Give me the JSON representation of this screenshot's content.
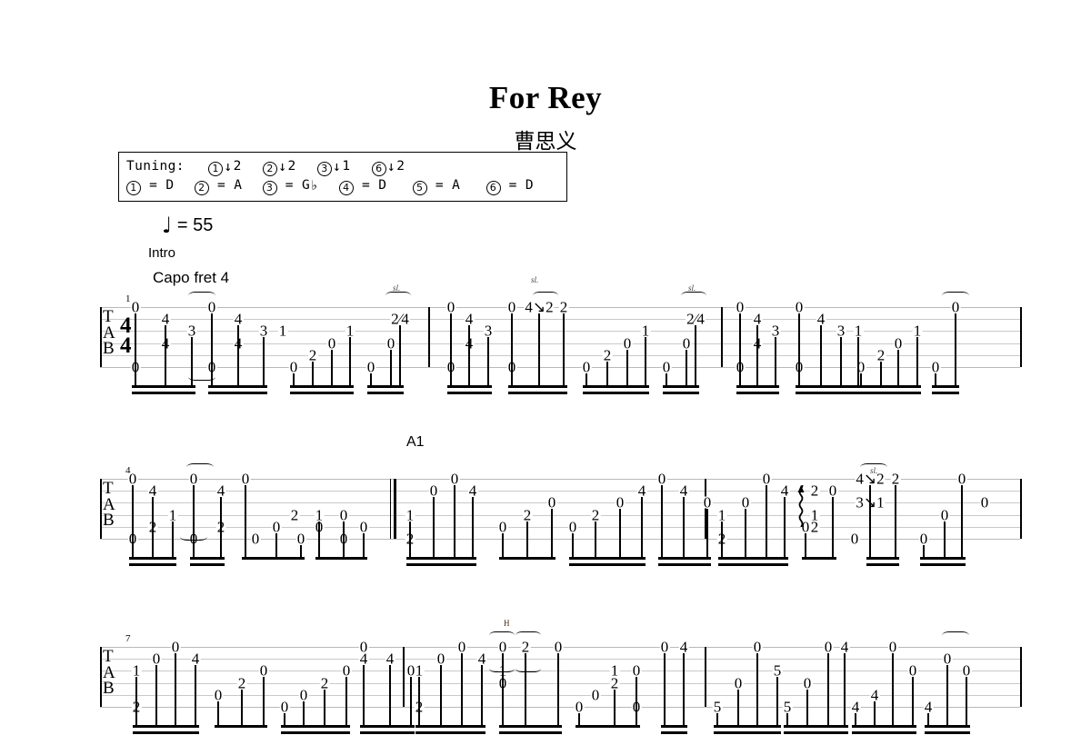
{
  "header": {
    "title": "For Rey",
    "composer": "曹思义",
    "tempo_note": "♩",
    "tempo_text": "= 55",
    "tempo_value": 55
  },
  "tuning_box": {
    "label": "Tuning:",
    "changes": [
      {
        "string": "1",
        "dir": "down",
        "amount": "2"
      },
      {
        "string": "2",
        "dir": "down",
        "amount": "2"
      },
      {
        "string": "3",
        "dir": "down",
        "amount": "1"
      },
      {
        "string": "6",
        "dir": "down",
        "amount": "2"
      }
    ],
    "strings": [
      {
        "string": "1",
        "note": "D"
      },
      {
        "string": "2",
        "note": "A"
      },
      {
        "string": "3",
        "note": "G",
        "accidental": "♭"
      },
      {
        "string": "4",
        "note": "D"
      },
      {
        "string": "5",
        "note": "A"
      },
      {
        "string": "6",
        "note": "D"
      }
    ]
  },
  "markers": {
    "intro": "Intro",
    "capo": "Capo fret 4",
    "a1": "A1"
  },
  "staff": {
    "clef": "TAB",
    "clef_letters": [
      "T",
      "A",
      "B"
    ],
    "time_signature": {
      "beats": "4",
      "unit": "4"
    },
    "num_strings": 6
  },
  "systems": [
    {
      "measure_start": 1,
      "measure_numbers": [
        "1"
      ],
      "measures": [
        {
          "number": "1",
          "notes": [
            {
              "string": 1,
              "fret": "0"
            },
            {
              "string": 2,
              "fret": "4"
            },
            {
              "string": 3,
              "fret": "3"
            },
            {
              "string": 4,
              "fret": "4"
            },
            {
              "string": 6,
              "fret": "0"
            },
            {
              "string": 1,
              "fret": "0"
            },
            {
              "string": 2,
              "fret": "4"
            },
            {
              "string": 3,
              "fret": "3"
            },
            {
              "string": 3,
              "fret": "1"
            },
            {
              "string": 4,
              "fret": "4"
            },
            {
              "string": 6,
              "fret": "0"
            },
            {
              "string": 5,
              "fret": "2"
            },
            {
              "string": 4,
              "fret": "0"
            },
            {
              "string": 3,
              "fret": "1"
            },
            {
              "string": 6,
              "fret": "0"
            },
            {
              "string": 4,
              "fret": "0"
            },
            {
              "string": 2,
              "fret": "2⁄4",
              "slide": true
            }
          ]
        },
        {
          "number": "2",
          "notes": [
            {
              "string": 1,
              "fret": "0"
            },
            {
              "string": 2,
              "fret": "4"
            },
            {
              "string": 3,
              "fret": "3"
            },
            {
              "string": 4,
              "fret": "4"
            },
            {
              "string": 6,
              "fret": "0"
            },
            {
              "string": 1,
              "fret": "0"
            },
            {
              "string": 1,
              "fret": "4↘2"
            },
            {
              "string": 1,
              "fret": "2"
            },
            {
              "string": 6,
              "fret": "0"
            },
            {
              "string": 5,
              "fret": "2"
            },
            {
              "string": 4,
              "fret": "0"
            },
            {
              "string": 3,
              "fret": "1"
            },
            {
              "string": 6,
              "fret": "0"
            },
            {
              "string": 4,
              "fret": "0"
            },
            {
              "string": 2,
              "fret": "2⁄4",
              "slide": true
            }
          ]
        },
        {
          "number": "3",
          "notes": [
            {
              "string": 1,
              "fret": "0"
            },
            {
              "string": 2,
              "fret": "4"
            },
            {
              "string": 3,
              "fret": "3"
            },
            {
              "string": 4,
              "fret": "4"
            },
            {
              "string": 6,
              "fret": "0"
            },
            {
              "string": 1,
              "fret": "0"
            },
            {
              "string": 2,
              "fret": "4"
            },
            {
              "string": 3,
              "fret": "3"
            },
            {
              "string": 3,
              "fret": "1"
            },
            {
              "string": 6,
              "fret": "0"
            },
            {
              "string": 5,
              "fret": "2"
            },
            {
              "string": 4,
              "fret": "0"
            },
            {
              "string": 3,
              "fret": "1"
            },
            {
              "string": 6,
              "fret": "0"
            },
            {
              "string": 1,
              "fret": "0"
            }
          ]
        }
      ]
    },
    {
      "measure_start": 4,
      "measure_numbers": [
        "4"
      ],
      "section": "A1",
      "measures": [
        {
          "number": "4",
          "notes": [
            {
              "string": 1,
              "fret": "0"
            },
            {
              "string": 2,
              "fret": "4"
            },
            {
              "string": 4,
              "fret": "2"
            },
            {
              "string": 3,
              "fret": "1"
            },
            {
              "string": 6,
              "fret": "0"
            },
            {
              "string": 1,
              "fret": "0"
            },
            {
              "string": 2,
              "fret": "4"
            },
            {
              "string": 4,
              "fret": "2"
            },
            {
              "string": 6,
              "fret": "0"
            },
            {
              "string": 5,
              "fret": "0"
            },
            {
              "string": 4,
              "fret": "2"
            },
            {
              "string": 3,
              "fret": "1"
            },
            {
              "string": 5,
              "fret": "0"
            },
            {
              "string": 4,
              "fret": "0"
            },
            {
              "string": 3,
              "fret": "0"
            },
            {
              "string": 1,
              "fret": "0"
            }
          ]
        },
        {
          "number": "5",
          "notes": [
            {
              "string": 3,
              "fret": "1"
            },
            {
              "string": 6,
              "fret": "2"
            },
            {
              "string": 2,
              "fret": "0"
            },
            {
              "string": 1,
              "fret": "0"
            },
            {
              "string": 2,
              "fret": "4"
            },
            {
              "string": 5,
              "fret": "0"
            },
            {
              "string": 4,
              "fret": "2"
            },
            {
              "string": 3,
              "fret": "0"
            },
            {
              "string": 5,
              "fret": "0"
            },
            {
              "string": 4,
              "fret": "2"
            },
            {
              "string": 3,
              "fret": "0"
            },
            {
              "string": 2,
              "fret": "4"
            },
            {
              "string": 1,
              "fret": "0"
            },
            {
              "string": 2,
              "fret": "4"
            },
            {
              "string": 3,
              "fret": "0"
            }
          ]
        },
        {
          "number": "6",
          "notes": [
            {
              "string": 3,
              "fret": "1"
            },
            {
              "string": 6,
              "fret": "2"
            },
            {
              "string": 2,
              "fret": "0"
            },
            {
              "string": 1,
              "fret": "0"
            },
            {
              "string": 2,
              "fret": "4"
            },
            {
              "string": 5,
              "fret": "0"
            },
            {
              "string": 2,
              "fret": "2"
            },
            {
              "string": 3,
              "fret": "1"
            },
            {
              "string": 4,
              "fret": "2"
            },
            {
              "string": 2,
              "fret": "0"
            },
            {
              "string": 1,
              "fret": "4↘2"
            },
            {
              "string": 1,
              "fret": "2"
            },
            {
              "string": 3,
              "fret": "3↘1"
            },
            {
              "string": 6,
              "fret": "0"
            },
            {
              "string": 6,
              "fret": "0"
            },
            {
              "string": 4,
              "fret": "0"
            },
            {
              "string": 1,
              "fret": "0"
            },
            {
              "string": 3,
              "fret": "0"
            }
          ],
          "arpeggio": true
        }
      ]
    },
    {
      "measure_start": 7,
      "measure_numbers": [
        "7"
      ],
      "measures": [
        {
          "number": "7",
          "notes": [
            {
              "string": 3,
              "fret": "1"
            },
            {
              "string": 6,
              "fret": "2"
            },
            {
              "string": 2,
              "fret": "0"
            },
            {
              "string": 1,
              "fret": "0"
            },
            {
              "string": 2,
              "fret": "4"
            },
            {
              "string": 5,
              "fret": "0"
            },
            {
              "string": 4,
              "fret": "2"
            },
            {
              "string": 3,
              "fret": "0"
            },
            {
              "string": 6,
              "fret": "0"
            },
            {
              "string": 5,
              "fret": "0"
            },
            {
              "string": 4,
              "fret": "2"
            },
            {
              "string": 3,
              "fret": "0"
            },
            {
              "string": 2,
              "fret": "4"
            },
            {
              "string": 1,
              "fret": "0"
            },
            {
              "string": 2,
              "fret": "4"
            },
            {
              "string": 3,
              "fret": "0"
            }
          ]
        },
        {
          "number": "8",
          "notes": [
            {
              "string": 3,
              "fret": "1"
            },
            {
              "string": 6,
              "fret": "2"
            },
            {
              "string": 2,
              "fret": "0"
            },
            {
              "string": 1,
              "fret": "0"
            },
            {
              "string": 2,
              "fret": "4"
            },
            {
              "string": 1,
              "fret": "0"
            },
            {
              "string": 1,
              "fret": "2"
            },
            {
              "string": 3,
              "fret": "1"
            },
            {
              "string": 4,
              "fret": "0"
            },
            {
              "string": 1,
              "fret": "0"
            },
            {
              "string": 6,
              "fret": "0"
            },
            {
              "string": 5,
              "fret": "0"
            },
            {
              "string": 4,
              "fret": "2"
            },
            {
              "string": 3,
              "fret": "1"
            },
            {
              "string": 3,
              "fret": "0"
            },
            {
              "string": 6,
              "fret": "0"
            },
            {
              "string": 1,
              "fret": "0"
            },
            {
              "string": 1,
              "fret": "4"
            }
          ],
          "hammer": "H"
        },
        {
          "number": "9",
          "notes": [
            {
              "string": 6,
              "fret": "5"
            },
            {
              "string": 4,
              "fret": "0"
            },
            {
              "string": 1,
              "fret": "0"
            },
            {
              "string": 3,
              "fret": "5"
            },
            {
              "string": 6,
              "fret": "5"
            },
            {
              "string": 4,
              "fret": "0"
            },
            {
              "string": 1,
              "fret": "0"
            },
            {
              "string": 1,
              "fret": "4"
            },
            {
              "string": 6,
              "fret": "4"
            },
            {
              "string": 5,
              "fret": "4"
            },
            {
              "string": 1,
              "fret": "0"
            },
            {
              "string": 3,
              "fret": "0"
            },
            {
              "string": 6,
              "fret": "4"
            },
            {
              "string": 2,
              "fret": "0"
            },
            {
              "string": 3,
              "fret": "0"
            }
          ]
        }
      ]
    }
  ],
  "articulations": {
    "slide_label": "sl.",
    "hammer_label": "H"
  }
}
